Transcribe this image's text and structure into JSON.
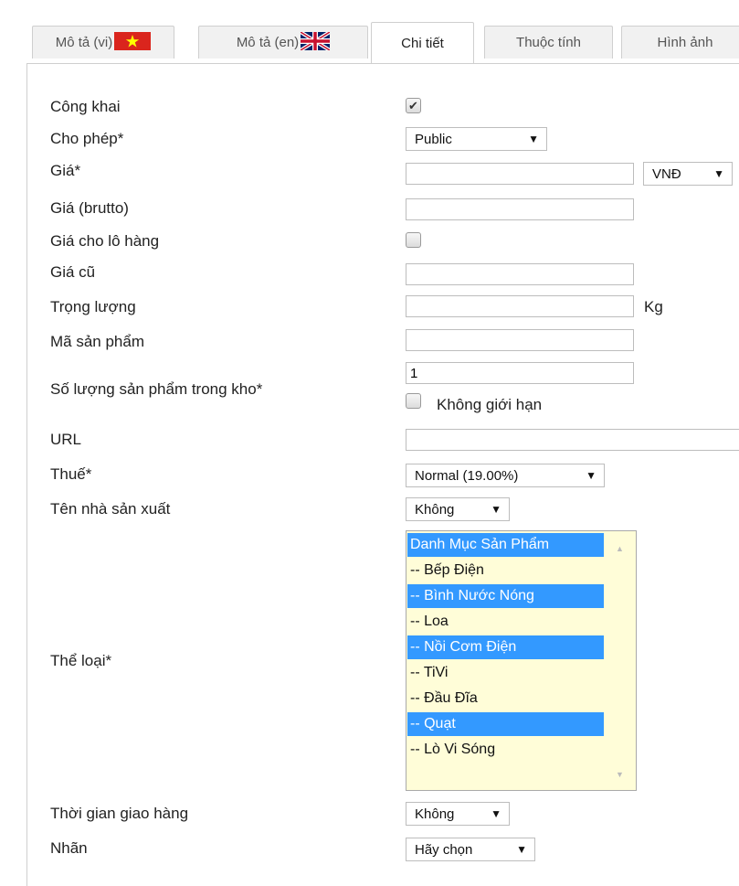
{
  "tabs": [
    {
      "label": "Mô tả (vi)",
      "flag": "vietnam-flag-icon"
    },
    {
      "label": "Mô tả (en)",
      "flag": "uk-flag-icon"
    },
    {
      "label": "Chi tiết"
    },
    {
      "label": "Thuộc tính"
    },
    {
      "label": "Hình ảnh"
    }
  ],
  "fields": {
    "public": {
      "label": "Công khai",
      "checked": true
    },
    "permission": {
      "label": "Cho phép*",
      "value": "Public"
    },
    "price": {
      "label": "Giá*",
      "value": "",
      "currency": "VNĐ"
    },
    "price_gross": {
      "label": "Giá (brutto)",
      "value": ""
    },
    "bulk_price": {
      "label": "Giá cho lô hàng",
      "checked": false
    },
    "old_price": {
      "label": "Giá cũ",
      "value": ""
    },
    "weight": {
      "label": "Trọng lượng",
      "value": "",
      "unit": "Kg"
    },
    "sku": {
      "label": "Mã sản phẩm",
      "value": ""
    },
    "stock": {
      "label": "Số lượng sản phẩm trong kho*",
      "value": "1",
      "unlimited_label": "Không giới hạn",
      "unlimited": false
    },
    "url": {
      "label": "URL",
      "value": ""
    },
    "tax": {
      "label": "Thuế*",
      "value": "Normal (19.00%)"
    },
    "manufacturer": {
      "label": "Tên nhà sản xuất",
      "value": "Không"
    },
    "category": {
      "label": "Thể loại*",
      "options": [
        {
          "text": "Danh Mục Sản Phẩm",
          "selected": true
        },
        {
          "text": "-- Bếp Điện",
          "selected": false
        },
        {
          "text": "-- Bình Nước Nóng",
          "selected": true
        },
        {
          "text": "-- Loa",
          "selected": false
        },
        {
          "text": "-- Nồi Cơm Điện",
          "selected": true
        },
        {
          "text": "-- TiVi",
          "selected": false
        },
        {
          "text": "-- Đầu Đĩa",
          "selected": false
        },
        {
          "text": "-- Quạt",
          "selected": true
        },
        {
          "text": "-- Lò Vi Sóng",
          "selected": false
        }
      ]
    },
    "delivery_time": {
      "label": "Thời gian giao hàng",
      "value": "Không"
    },
    "badge": {
      "label": "Nhãn",
      "value": "Hãy chọn"
    }
  },
  "colors": {
    "selected_option": "#3399ff",
    "listbox_bg": "#fffdd8"
  }
}
